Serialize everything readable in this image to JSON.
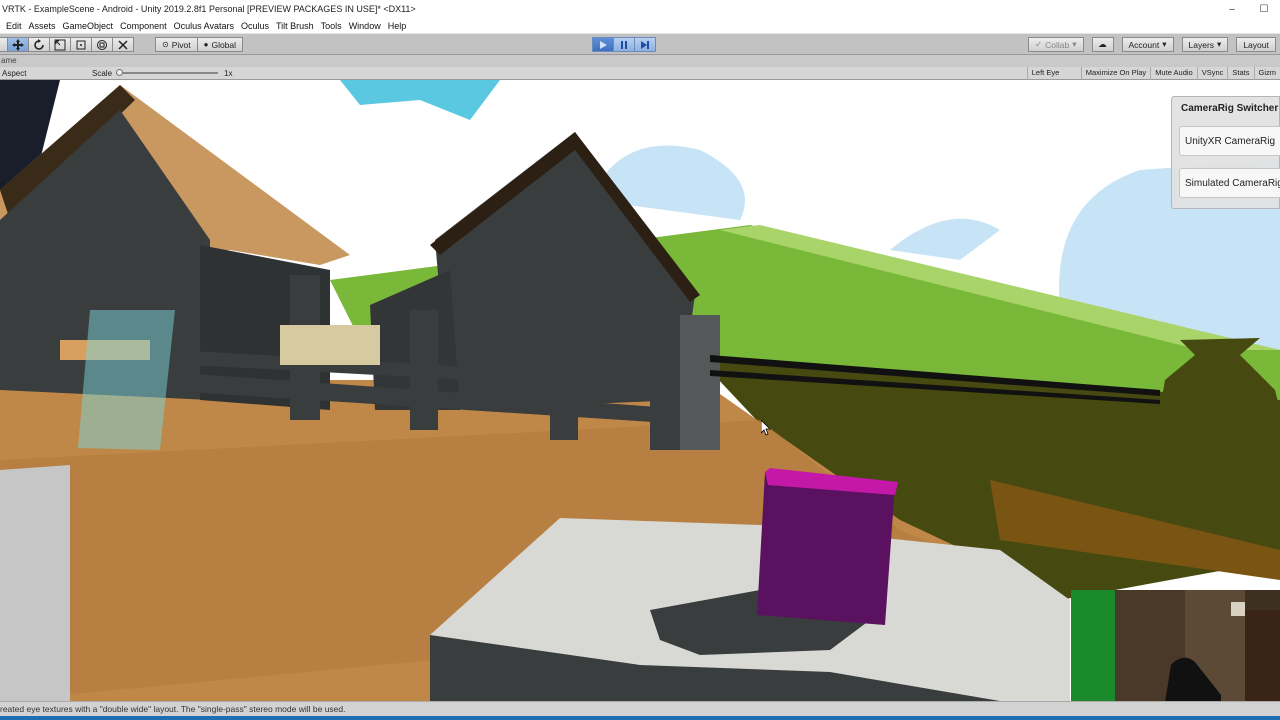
{
  "window": {
    "title": "VRTK - ExampleScene - Android - Unity 2019.2.8f1 Personal [PREVIEW PACKAGES IN USE]* <DX11>",
    "minimize_glyph": "–",
    "maximize_glyph": "☐"
  },
  "menu": {
    "items": [
      "Edit",
      "Assets",
      "GameObject",
      "Component",
      "Oculus Avatars",
      "Oculus",
      "Tilt Brush",
      "Tools",
      "Window",
      "Help"
    ]
  },
  "toolbar": {
    "pivot_label": "Pivot",
    "global_label": "Global",
    "collab_label": "Collab",
    "account_label": "Account",
    "layers_label": "Layers",
    "layout_label": "Layout"
  },
  "game_view": {
    "tab_label": "ame",
    "aspect_label": "Aspect",
    "scale_label": "Scale",
    "scale_value": "1x",
    "eye_label": "Left Eye",
    "maximize_on_play": "Maximize On Play",
    "mute_audio": "Mute Audio",
    "vsync": "VSync",
    "stats": "Stats",
    "gizmos": "Gizm"
  },
  "switcher": {
    "title": "CameraRig Switcher",
    "buttons": [
      "UnityXR CameraRig",
      "Simulated CameraRig"
    ]
  },
  "status": {
    "message": "reated eye textures with a \"double wide\" layout. The \"single-pass\" stereo mode will be used."
  },
  "colors": {
    "sky": "#ffffff",
    "cloud": "#5ac8e0",
    "grass": "#7ab83a",
    "dirt": "#c08848",
    "roof": "#c89860",
    "barn": "#3a3d3d",
    "cube": "#5a1260",
    "accent": "#3d70c0"
  }
}
